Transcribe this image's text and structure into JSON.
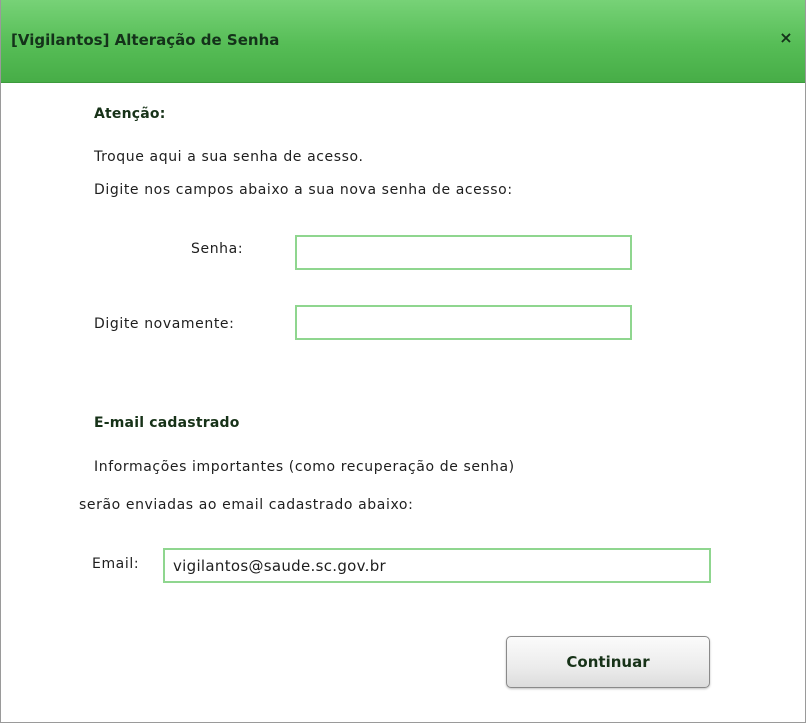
{
  "dialog": {
    "title": "[Vigilantos] Alteração de Senha",
    "close_symbol": "×"
  },
  "password_section": {
    "heading": "Atenção:",
    "line1": "Troque aqui a sua senha de acesso.",
    "line2": "Digite nos campos abaixo a sua nova senha de acesso:",
    "password_label": "Senha:",
    "password_value": "",
    "confirm_label": "Digite novamente:",
    "confirm_value": ""
  },
  "email_section": {
    "heading": "E-mail cadastrado",
    "info_line1": "Informações importantes (como recuperação de senha)",
    "info_line2": "serão enviadas ao email cadastrado abaixo:",
    "email_label": "Email:",
    "email_value": "vigilantos@saude.sc.gov.br"
  },
  "actions": {
    "continue_label": "Continuar"
  },
  "colors": {
    "titlebar": "#56bd56",
    "field_border": "#8fd68f",
    "heading_text": "#173218"
  }
}
